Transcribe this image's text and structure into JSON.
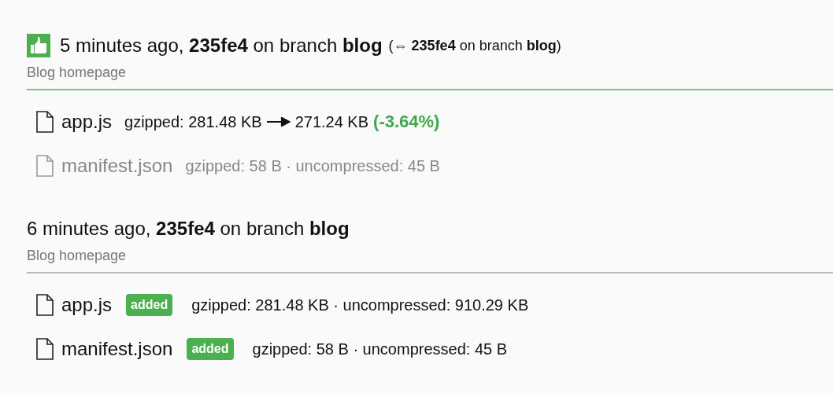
{
  "builds": [
    {
      "passed": true,
      "heading": "5 minutes ago, **235fe4** on branch **blog**",
      "compare": "(⇔ **235fe4** on branch **blog**)",
      "subtitle": "Blog homepage",
      "files": [
        {
          "name": "app.js",
          "kind": "changed",
          "size": "gzipped: 281.48 KB",
          "new_size": "271.24 KB",
          "change": "(-3.64%)",
          "color": "#3fa94a"
        },
        {
          "name": "manifest.json",
          "kind": "unchanged",
          "size": "gzipped: 58 B · uncompressed: 45 B"
        }
      ]
    },
    {
      "passed": false,
      "heading": "6 minutes ago, **235fe4** on branch **blog**",
      "subtitle": "Blog homepage",
      "files": [
        {
          "name": "app.js",
          "kind": "added",
          "badge": "added",
          "size": "gzipped: 281.48 KB · uncompressed: 910.29 KB"
        },
        {
          "name": "manifest.json",
          "kind": "added",
          "badge": "added",
          "size": "gzipped: 58 B · uncompressed: 45 B"
        }
      ]
    }
  ]
}
